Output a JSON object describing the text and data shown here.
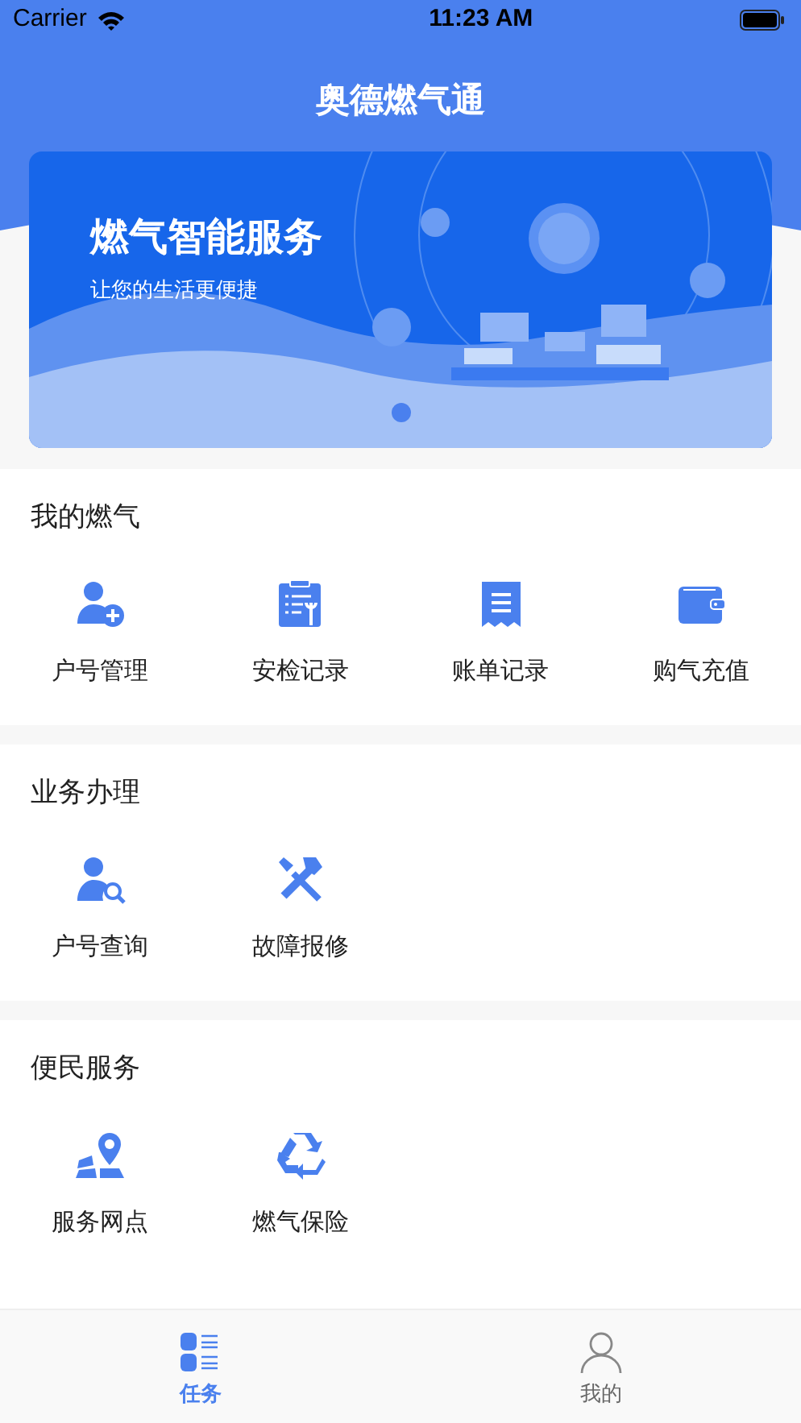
{
  "status_bar": {
    "carrier": "Carrier",
    "time": "11:23 AM"
  },
  "header": {
    "title": "奥德燃气通"
  },
  "banner": {
    "title": "燃气智能服务",
    "subtitle": "让您的生活更便捷",
    "pages": [
      {
        "selected": true
      }
    ]
  },
  "sections": [
    {
      "title": "我的燃气",
      "items": [
        {
          "label": "户号管理"
        },
        {
          "label": "安检记录"
        },
        {
          "label": "账单记录"
        },
        {
          "label": "购气充值"
        }
      ]
    },
    {
      "title": "业务办理",
      "items": [
        {
          "label": "户号查询"
        },
        {
          "label": "故障报修"
        }
      ]
    },
    {
      "title": "便民服务",
      "items": [
        {
          "label": "服务网点"
        },
        {
          "label": "燃气保险"
        }
      ]
    }
  ],
  "tabs": [
    {
      "label": "任务",
      "selected": true
    },
    {
      "label": "我的",
      "selected": false
    }
  ]
}
